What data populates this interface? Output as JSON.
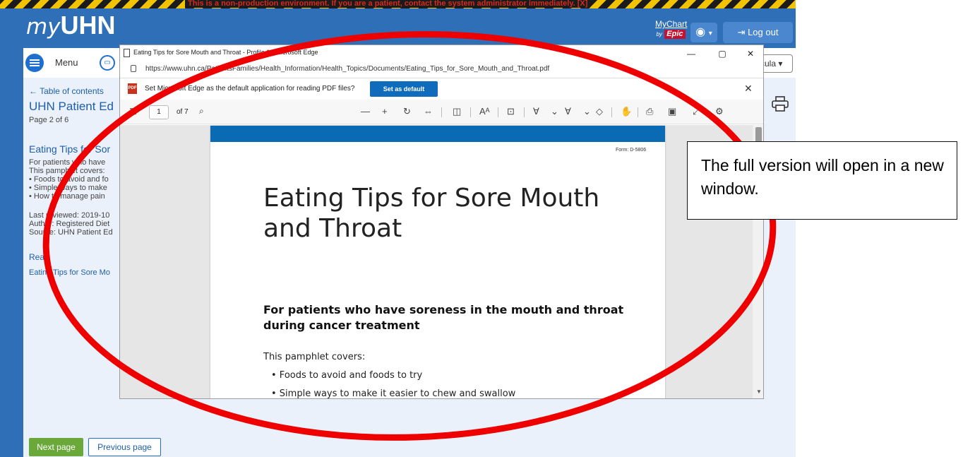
{
  "banner": {
    "warning": "This is a non-production environment. If you are a patient, contact the system administrator immediately. [X]"
  },
  "header": {
    "logo_prefix": "my",
    "logo_main": "UHN",
    "mychart_line1": "MyChart",
    "mychart_by": "by",
    "mychart_epic": "Epic",
    "lang_icon": "globe-icon",
    "lang_caret": "▾",
    "logout_label": "Log out"
  },
  "menubar": {
    "menu_label": "Menu",
    "user_name": "cula"
  },
  "left": {
    "toc_link": "← Table of contents",
    "page_title": "UHN Patient Ed",
    "page_count": "Page 2 of 6",
    "section_title": "Eating Tips for Sor",
    "summary_lines": [
      "For patients who have",
      "This pamphlet covers:",
      "• Foods to avoid and fo",
      "• Simple ways to make",
      "• How to manage pain"
    ],
    "meta_lines": [
      "Last reviewed: 2019-10",
      "Author: Registered Diet",
      "Source: UHN Patient Ed"
    ],
    "read_label": "Read",
    "read_link": "Eating Tips for Sore Mo"
  },
  "footer": {
    "next_label": "Next page",
    "prev_label": "Previous page"
  },
  "edge": {
    "window_title": "Eating Tips for Sore Mouth and Throat - Profile 1 - Microsoft Edge",
    "url": "https://www.uhn.ca/PatientsFamilies/Health_Information/Health_Topics/Documents/Eating_Tips_for_Sore_Mouth_and_Throat.pdf",
    "infobar_text": "Set Microsoft Edge as the default application for reading PDF files?",
    "set_default_label": "Set as default",
    "page_number": "1",
    "page_of": "of 7",
    "controls": {
      "minimize": "—",
      "maximize": "▢",
      "close": "✕"
    }
  },
  "pdf": {
    "form_no": "Form: D-5806",
    "title": "Eating Tips for Sore Mouth and Throat",
    "subtitle": "For patients who have soreness in the mouth and throat during cancer treatment",
    "covers_label": "This pamphlet covers:",
    "bullets": [
      "• Foods to avoid and foods to try",
      "• Simple ways to make it easier to chew and swallow"
    ]
  },
  "annotation": {
    "note": "The full version will open in a new window.",
    "ellipse_color": "#ee0000"
  }
}
